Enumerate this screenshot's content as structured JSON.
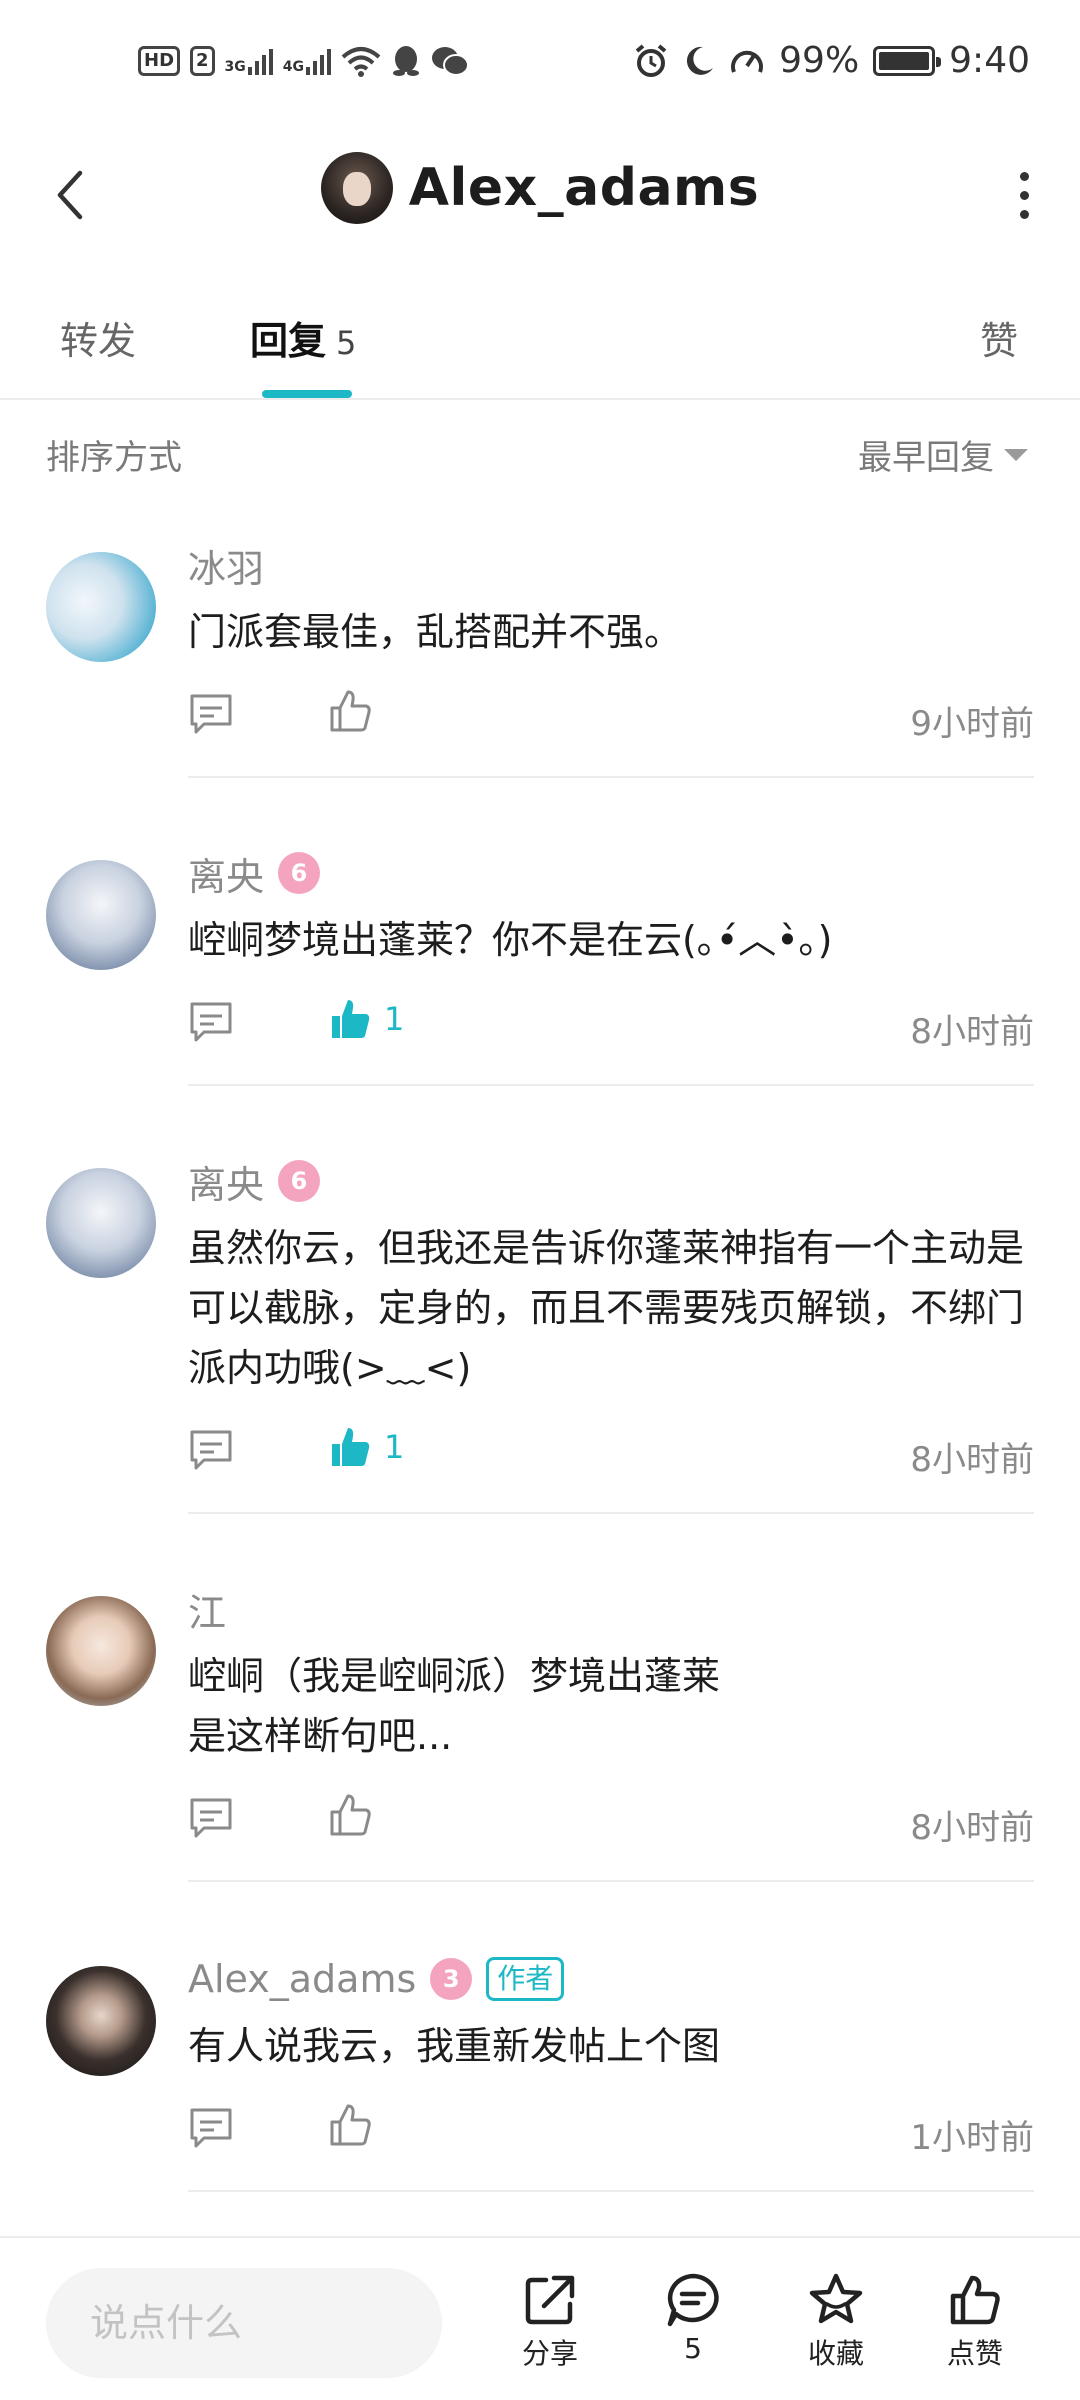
{
  "status_bar": {
    "hd": "HD",
    "sim": "2",
    "net1": "3G",
    "net2": "4G",
    "battery": "99%",
    "time": "9:40",
    "icons": [
      "signal-icon",
      "wifi-icon",
      "qq-icon",
      "wechat-icon",
      "alarm-icon",
      "moon-icon",
      "speed-icon",
      "battery-icon"
    ]
  },
  "header": {
    "title": "Alex_adams",
    "icons": [
      "back-icon",
      "more-icon"
    ]
  },
  "tabs": {
    "repost": "转发",
    "reply": "回复",
    "reply_count": "5",
    "like": "赞",
    "active": "reply"
  },
  "sort": {
    "label": "排序方式",
    "value": "最早回复"
  },
  "comments": [
    {
      "name": "冰羽",
      "badge": "",
      "author_tag": "",
      "text": "门派套最佳，乱搭配并不强。",
      "likes": "",
      "liked": false,
      "time": "9小时前"
    },
    {
      "name": "离央",
      "badge": "6",
      "author_tag": "",
      "text": "崆峒梦境出蓬莱？你不是在云(｡•́︿•̀｡)",
      "likes": "1",
      "liked": true,
      "time": "8小时前"
    },
    {
      "name": "离央",
      "badge": "6",
      "author_tag": "",
      "text": "虽然你云，但我还是告诉你蓬莱神指有一个主动是可以截脉，定身的，而且不需要残页解锁，不绑门派内功哦(>﹏<)",
      "likes": "1",
      "liked": true,
      "time": "8小时前"
    },
    {
      "name": "江",
      "badge": "",
      "author_tag": "",
      "text_lines": [
        "崆峒（我是崆峒派）梦境出蓬莱",
        "是这样断句吧..."
      ],
      "likes": "",
      "liked": false,
      "time": "8小时前"
    },
    {
      "name": "Alex_adams",
      "badge": "3",
      "author_tag": "作者",
      "text": "有人说我云，我重新发帖上个图",
      "likes": "",
      "liked": false,
      "time": "1小时前"
    }
  ],
  "bottom_bar": {
    "input_placeholder": "说点什么",
    "share": "分享",
    "comment_count": "5",
    "favorite": "收藏",
    "like": "点赞"
  },
  "colors": {
    "accent": "#1db8c6",
    "badge_pink": "#f5a4bf",
    "muted_text": "#8a8a8a"
  }
}
